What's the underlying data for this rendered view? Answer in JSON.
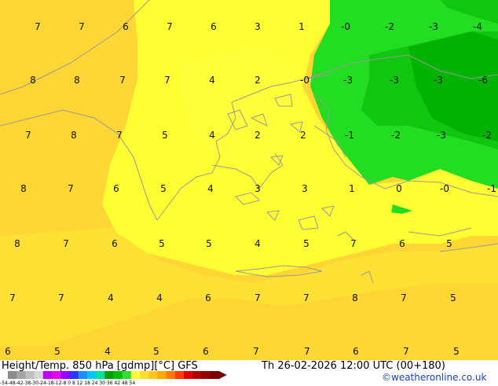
{
  "map": {
    "values": [
      {
        "v": "7"
      },
      {
        "v": "7"
      },
      {
        "v": "6"
      },
      {
        "v": "7"
      },
      {
        "v": "6"
      },
      {
        "v": "3"
      },
      {
        "v": "1"
      },
      {
        "v": "-0"
      },
      {
        "v": "-2"
      },
      {
        "v": "-3"
      },
      {
        "v": "-4"
      },
      {
        "v": "8"
      },
      {
        "v": "8"
      },
      {
        "v": "7"
      },
      {
        "v": "7"
      },
      {
        "v": "4"
      },
      {
        "v": "2"
      },
      {
        "v": "-0"
      },
      {
        "v": "-3"
      },
      {
        "v": "-3"
      },
      {
        "v": "-3"
      },
      {
        "v": "-6"
      },
      {
        "v": "7"
      },
      {
        "v": "8"
      },
      {
        "v": "7"
      },
      {
        "v": "5"
      },
      {
        "v": "4"
      },
      {
        "v": "2"
      },
      {
        "v": "2"
      },
      {
        "v": "-1"
      },
      {
        "v": "-2"
      },
      {
        "v": "-3"
      },
      {
        "v": "-2"
      },
      {
        "v": "8"
      },
      {
        "v": "7"
      },
      {
        "v": "6"
      },
      {
        "v": "5"
      },
      {
        "v": "4"
      },
      {
        "v": "3"
      },
      {
        "v": "3"
      },
      {
        "v": "1"
      },
      {
        "v": "0"
      },
      {
        "v": "-0"
      },
      {
        "v": "-1"
      },
      {
        "v": "8"
      },
      {
        "v": "7"
      },
      {
        "v": "6"
      },
      {
        "v": "5"
      },
      {
        "v": "5"
      },
      {
        "v": "4"
      },
      {
        "v": "5"
      },
      {
        "v": "7"
      },
      {
        "v": "6"
      },
      {
        "v": "5"
      },
      {
        "v": "7"
      },
      {
        "v": "7"
      },
      {
        "v": "4"
      },
      {
        "v": "4"
      },
      {
        "v": "6"
      },
      {
        "v": "7"
      },
      {
        "v": "7"
      },
      {
        "v": "8"
      },
      {
        "v": "7"
      },
      {
        "v": "5"
      },
      {
        "v": "6"
      },
      {
        "v": "5"
      },
      {
        "v": "4"
      },
      {
        "v": "5"
      },
      {
        "v": "6"
      },
      {
        "v": "7"
      },
      {
        "v": "7"
      },
      {
        "v": "6"
      },
      {
        "v": "7"
      },
      {
        "v": "5"
      }
    ],
    "colors": {
      "yellow_light": "#ffff33",
      "yellow": "#ffe135",
      "orange_yellow": "#ffd634",
      "green_light": "#22dd22",
      "green_mid": "#11c611",
      "green_dark": "#00b300",
      "coastline": "#9a9a9a"
    }
  },
  "footer": {
    "title": "Height/Temp. 850 hPa [gdmp][°C] GFS",
    "datetime": "Th 26-02-2026 12:00 UTC (00+180)",
    "credit": "©weatheronline.co.uk",
    "scale_ticks": "-54-48-42-38-30-24-18-12-8  0  8 12 18 24 30 36 42 48 54",
    "scale_colors": [
      "#8c8c8c",
      "#a5a5a5",
      "#bfbfbf",
      "#d7d7d7",
      "#c000ff",
      "#e800e8",
      "#9a00ff",
      "#3030ff",
      "#1c8cff",
      "#00c8ff",
      "#00e0a0",
      "#00a000",
      "#00c000",
      "#32dc32",
      "#ffff33",
      "#ffe135",
      "#ffc820",
      "#ffa800",
      "#ff7800",
      "#ff3c00",
      "#e00000",
      "#b40000",
      "#960000",
      "#780000"
    ]
  }
}
